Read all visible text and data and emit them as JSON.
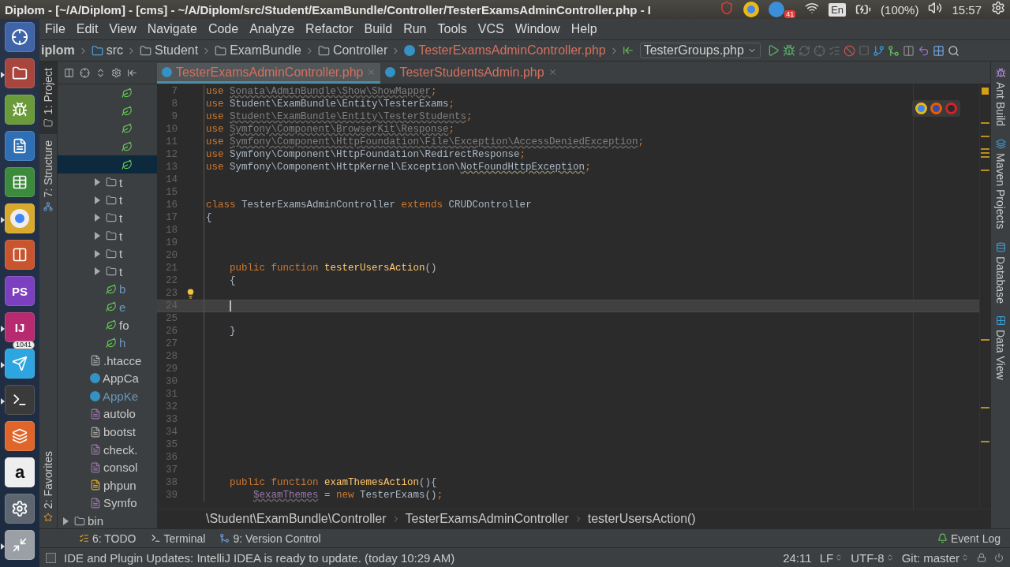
{
  "top_panel": {
    "title": "Diplom - [~/A/Diplom] - [cms] - ~/A/Diplom/src/Student/ExamBundle/Controller/TesterExamsAdminController.php - I",
    "tray": [
      {
        "kind": "shield"
      },
      {
        "kind": "browser"
      },
      {
        "kind": "mail",
        "badge": "41"
      },
      {
        "kind": "wifi"
      },
      {
        "kind": "keyboard",
        "label": "En"
      },
      {
        "kind": "battery",
        "label": "(100%)"
      },
      {
        "kind": "volume"
      },
      {
        "kind": "clock",
        "label": "15:57"
      },
      {
        "kind": "gear"
      }
    ]
  },
  "launcher": [
    {
      "kind": "dash",
      "running": false
    },
    {
      "kind": "files",
      "running": true
    },
    {
      "kind": "android",
      "running": false
    },
    {
      "kind": "writer",
      "running": false
    },
    {
      "kind": "calc",
      "running": false
    },
    {
      "kind": "browser",
      "running": true
    },
    {
      "kind": "impress",
      "running": false
    },
    {
      "kind": "phpstorm",
      "label": "PS",
      "running": false
    },
    {
      "kind": "intellij",
      "label": "IJ",
      "running": true
    },
    {
      "kind": "telegram",
      "badge": "1041",
      "running": true
    },
    {
      "kind": "terminal",
      "running": true
    },
    {
      "kind": "software",
      "running": false
    },
    {
      "kind": "amazon",
      "label": "a",
      "running": false
    },
    {
      "kind": "settings",
      "running": false
    },
    {
      "kind": "scanner",
      "running": true
    }
  ],
  "menu": [
    "File",
    "Edit",
    "View",
    "Navigate",
    "Code",
    "Analyze",
    "Refactor",
    "Build",
    "Run",
    "Tools",
    "VCS",
    "Window",
    "Help"
  ],
  "navbar": {
    "crumbs": [
      {
        "text": "iplom",
        "kind": "project"
      },
      {
        "text": "src",
        "kind": "source-folder"
      },
      {
        "text": "Student",
        "kind": "folder"
      },
      {
        "text": "ExamBundle",
        "kind": "folder"
      },
      {
        "text": "Controller",
        "kind": "folder"
      },
      {
        "text": "TesterExamsAdminController.php",
        "kind": "class-file"
      }
    ],
    "run_config": "TesterGroups.php"
  },
  "left_tool_tabs": [
    {
      "label": "1: Project",
      "kind": "project",
      "selected": true
    },
    {
      "label": "7: Structure",
      "kind": "structure",
      "selected": false
    },
    {
      "label": "2: Favorites",
      "kind": "favorites",
      "selected": false
    }
  ],
  "project_tree": [
    {
      "children": [
        {
          "children": [
            {
              "children": [
                {
                  "kind": "symfony",
                  "selected": false
                },
                {
                  "kind": "symfony",
                  "selected": false
                },
                {
                  "kind": "symfony",
                  "selected": false
                },
                {
                  "kind": "symfony",
                  "selected": false
                },
                {
                  "kind": "symfony",
                  "selected": true
                }
              ]
            },
            {
              "name": "t",
              "kind": "folder",
              "expanded": false,
              "selected": false,
              "modified": false
            },
            {
              "name": "t",
              "kind": "folder",
              "expanded": false,
              "selected": false,
              "modified": false
            },
            {
              "name": "t",
              "kind": "folder",
              "expanded": false,
              "selected": false,
              "modified": false
            },
            {
              "name": "t",
              "kind": "folder",
              "expanded": false,
              "selected": false,
              "modified": false
            },
            {
              "name": "t",
              "kind": "folder",
              "expanded": false,
              "selected": false,
              "modified": false
            },
            {
              "name": "t",
              "kind": "folder",
              "expanded": false,
              "selected": false,
              "modified": false
            },
            {
              "name": "b",
              "kind": "symfony",
              "selected": false,
              "modified": true
            },
            {
              "name": "e",
              "kind": "symfony",
              "selected": false,
              "modified": true
            },
            {
              "name": "fo",
              "kind": "symfony",
              "selected": false,
              "modified": false
            },
            {
              "name": "h",
              "kind": "symfony",
              "selected": false,
              "modified": true
            }
          ]
        },
        {
          "name": ".htacce",
          "kind": "text",
          "selected": false,
          "modified": false
        },
        {
          "name": "AppCa",
          "kind": "class",
          "selected": false,
          "modified": false
        },
        {
          "name": "AppKe",
          "kind": "class",
          "selected": false,
          "modified": true
        },
        {
          "name": "autolo",
          "kind": "php",
          "selected": false,
          "modified": false
        },
        {
          "name": "bootst",
          "kind": "text",
          "selected": false,
          "modified": false
        },
        {
          "name": "check.",
          "kind": "php",
          "selected": false,
          "modified": false
        },
        {
          "name": "consol",
          "kind": "php",
          "selected": false,
          "modified": false
        },
        {
          "name": "phpun",
          "kind": "config",
          "selected": false,
          "modified": false
        },
        {
          "name": "Symfo",
          "kind": "php",
          "selected": false,
          "modified": false
        }
      ]
    },
    {
      "name": "bin",
      "kind": "folder",
      "expanded": false,
      "selected": false,
      "modified": false
    }
  ],
  "editor": {
    "tabs": [
      {
        "label": "TesterExamsAdminController.php",
        "selected": true
      },
      {
        "label": "TesterStudentsAdmin.php",
        "selected": false
      }
    ],
    "lines": [
      {
        "n": "7",
        "current": false,
        "bulb": false,
        "tokens": [
          {
            "kind": "kw",
            "text": "use "
          },
          {
            "kind": "unused",
            "text": "Sonata\\AdminBundle\\Show\\ShowMapper"
          },
          {
            "kind": "kw",
            "text": ";"
          }
        ]
      },
      {
        "n": "8",
        "current": false,
        "bulb": false,
        "tokens": [
          {
            "kind": "kw",
            "text": "use"
          },
          {
            "kind": "plain",
            "text": " Student\\ExamBundle\\Entity\\TesterExams"
          },
          {
            "kind": "kw",
            "text": ";"
          }
        ]
      },
      {
        "n": "9",
        "current": false,
        "bulb": false,
        "tokens": [
          {
            "kind": "kw",
            "text": "use "
          },
          {
            "kind": "unused",
            "text": "Student\\ExamBundle\\Entity\\TesterStudents"
          },
          {
            "kind": "kw",
            "text": ";"
          }
        ]
      },
      {
        "n": "10",
        "current": false,
        "bulb": false,
        "tokens": [
          {
            "kind": "kw",
            "text": "use "
          },
          {
            "kind": "unused",
            "text": "Symfony\\Component\\BrowserKit\\Response"
          },
          {
            "kind": "kw",
            "text": ";"
          }
        ]
      },
      {
        "n": "11",
        "current": false,
        "bulb": false,
        "tokens": [
          {
            "kind": "kw",
            "text": "use "
          },
          {
            "kind": "unused",
            "text": "Symfony\\Component\\HttpFoundation\\File\\Exception\\AccessDeniedException"
          },
          {
            "kind": "kw",
            "text": ";"
          }
        ]
      },
      {
        "n": "12",
        "current": false,
        "bulb": false,
        "tokens": [
          {
            "kind": "kw",
            "text": "use"
          },
          {
            "kind": "plain",
            "text": " Symfony\\Component\\HttpFoundation\\RedirectResponse"
          },
          {
            "kind": "kw",
            "text": ";"
          }
        ]
      },
      {
        "n": "13",
        "current": false,
        "bulb": false,
        "tokens": [
          {
            "kind": "kw",
            "text": "use"
          },
          {
            "kind": "plain",
            "text": " Symfony\\Component\\HttpKernel\\Exception\\"
          },
          {
            "kind": "warn",
            "text": "NotFoundHttpException"
          },
          {
            "kind": "kw",
            "text": ";"
          }
        ]
      },
      {
        "n": "14",
        "current": false,
        "bulb": false
      },
      {
        "n": "15",
        "current": false,
        "bulb": false
      },
      {
        "n": "16",
        "current": false,
        "bulb": false,
        "tokens": [
          {
            "kind": "kw",
            "text": "class"
          },
          {
            "kind": "plain",
            "text": " TesterExamsAdminController "
          },
          {
            "kind": "kw",
            "text": "extends"
          },
          {
            "kind": "plain",
            "text": " CRUDController"
          }
        ]
      },
      {
        "n": "17",
        "current": false,
        "bulb": false,
        "tokens": [
          {
            "kind": "plain",
            "text": "{"
          }
        ]
      },
      {
        "n": "18",
        "current": false,
        "bulb": false
      },
      {
        "n": "19",
        "current": false,
        "bulb": false
      },
      {
        "n": "20",
        "current": false,
        "bulb": false
      },
      {
        "n": "21",
        "current": false,
        "bulb": false,
        "tokens": [
          {
            "kind": "kw",
            "text": "    public function "
          },
          {
            "kind": "method",
            "text": "testerUsersAction"
          },
          {
            "kind": "plain",
            "text": "()"
          }
        ]
      },
      {
        "n": "22",
        "current": false,
        "bulb": false,
        "tokens": [
          {
            "kind": "plain",
            "text": "    {"
          }
        ]
      },
      {
        "n": "23",
        "current": false,
        "bulb": true
      },
      {
        "n": "24",
        "current": true,
        "bulb": false
      },
      {
        "n": "25",
        "current": false,
        "bulb": false
      },
      {
        "n": "26",
        "current": false,
        "bulb": false,
        "tokens": [
          {
            "kind": "plain",
            "text": "    }"
          }
        ]
      },
      {
        "n": "27",
        "current": false,
        "bulb": false
      },
      {
        "n": "28",
        "current": false,
        "bulb": false
      },
      {
        "n": "29",
        "current": false,
        "bulb": false
      },
      {
        "n": "30",
        "current": false,
        "bulb": false
      },
      {
        "n": "31",
        "current": false,
        "bulb": false
      },
      {
        "n": "32",
        "current": false,
        "bulb": false
      },
      {
        "n": "33",
        "current": false,
        "bulb": false
      },
      {
        "n": "34",
        "current": false,
        "bulb": false
      },
      {
        "n": "35",
        "current": false,
        "bulb": false
      },
      {
        "n": "36",
        "current": false,
        "bulb": false
      },
      {
        "n": "37",
        "current": false,
        "bulb": false
      },
      {
        "n": "38",
        "current": false,
        "bulb": false,
        "tokens": [
          {
            "kind": "kw",
            "text": "    public function "
          },
          {
            "kind": "method",
            "text": "examThemesAction"
          },
          {
            "kind": "plain",
            "text": "(){"
          }
        ]
      },
      {
        "n": "39",
        "current": false,
        "bulb": false,
        "tokens": [
          {
            "kind": "var",
            "text": "        $examThemes"
          },
          {
            "kind": "plain",
            "text": " = "
          },
          {
            "kind": "kw",
            "text": "new"
          },
          {
            "kind": "plain",
            "text": " TesterExams()"
          },
          {
            "kind": "kw",
            "text": ";"
          }
        ]
      }
    ],
    "breadcrumbs": [
      "\\Student\\ExamBundle\\Controller",
      "TesterExamsAdminController",
      "testerUsersAction()"
    ]
  },
  "right_tool_tabs": [
    {
      "label": "Ant Build",
      "kind": "ant"
    },
    {
      "label": "Maven Projects",
      "kind": "maven"
    },
    {
      "label": "Database",
      "kind": "database"
    },
    {
      "label": "Data View",
      "kind": "dataview"
    }
  ],
  "bottom_tools": [
    {
      "label": "6: TODO",
      "kind": "todo"
    },
    {
      "label": "Terminal",
      "kind": "terminal"
    },
    {
      "label": "9: Version Control",
      "kind": "vcs"
    }
  ],
  "event_log": "Event Log",
  "status_bar": {
    "message": "IDE and Plugin Updates: IntelliJ IDEA is ready to update. (today 10:29 AM)",
    "position": "24:11",
    "line_separator": "LF",
    "encoding": "UTF-8",
    "vcs_branch": "Git: master"
  }
}
